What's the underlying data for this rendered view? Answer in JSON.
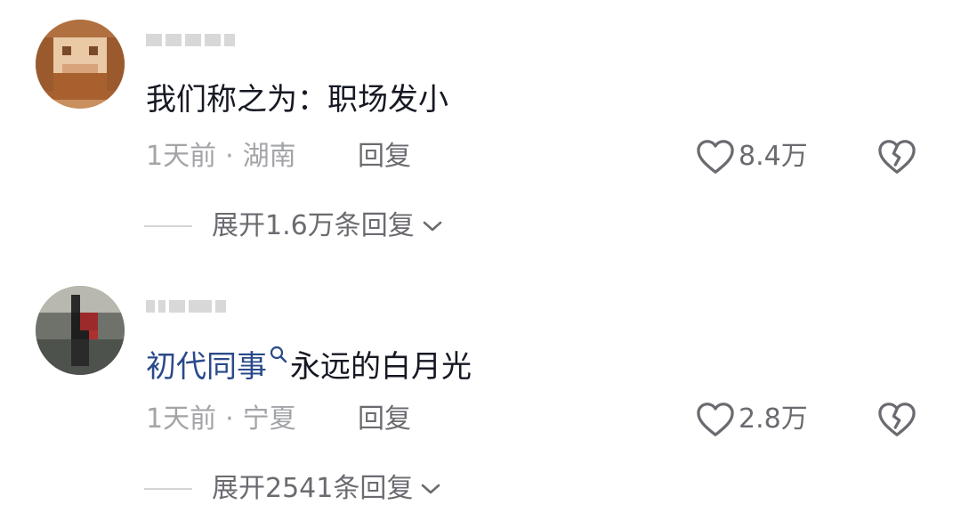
{
  "comments": [
    {
      "avatar_icon": "pixelated-avatar-icon",
      "content": "我们称之为：职场发小",
      "time": "1天前",
      "location": "湖南",
      "reply_label": "回复",
      "like_count": "8.4万",
      "expand_label": "展开1.6万条回复"
    },
    {
      "avatar_icon": "pixelated-avatar-icon",
      "content_link": "初代同事",
      "content_rest": "永远的白月光",
      "time": "1天前",
      "location": "宁夏",
      "reply_label": "回复",
      "like_count": "2.8万",
      "expand_label": "展开2541条回复"
    }
  ],
  "meta_separator": "·",
  "colors": {
    "text": "#161823",
    "link": "#2a4a8a",
    "meta": "#a3a4a8",
    "secondary": "#6a6b70"
  }
}
